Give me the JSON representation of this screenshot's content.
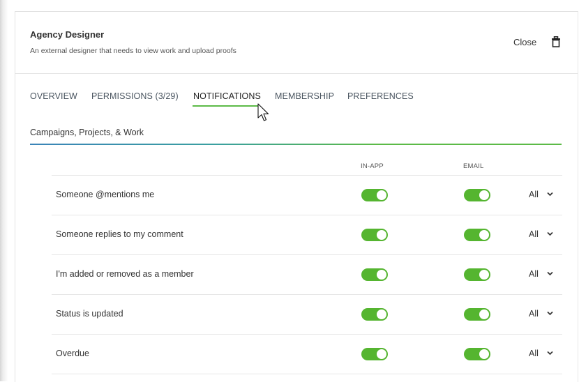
{
  "header": {
    "title": "Agency Designer",
    "subtitle": "An external designer that needs to view work and upload proofs",
    "close_label": "Close"
  },
  "tabs": [
    {
      "label": "OVERVIEW",
      "active": false
    },
    {
      "label": "PERMISSIONS (3/29)",
      "active": false
    },
    {
      "label": "NOTIFICATIONS",
      "active": true
    },
    {
      "label": "MEMBERSHIP",
      "active": false
    },
    {
      "label": "PREFERENCES",
      "active": false
    }
  ],
  "section": {
    "title": "Campaigns, Projects, & Work"
  },
  "table": {
    "columns": {
      "in_app": "IN-APP",
      "email": "EMAIL"
    },
    "rows": [
      {
        "label": "Someone @mentions me",
        "in_app": true,
        "email": true,
        "frequency": "All"
      },
      {
        "label": "Someone replies to my comment",
        "in_app": true,
        "email": true,
        "frequency": "All"
      },
      {
        "label": "I'm added or removed as a member",
        "in_app": true,
        "email": true,
        "frequency": "All"
      },
      {
        "label": "Status is updated",
        "in_app": true,
        "email": true,
        "frequency": "All"
      },
      {
        "label": "Overdue",
        "in_app": true,
        "email": true,
        "frequency": "All"
      }
    ]
  },
  "colors": {
    "accent": "#5cba47",
    "toggle_on": "#55b530",
    "rule_blue": "#3b84b8"
  },
  "icons": {
    "delete": "trash-icon",
    "dropdown": "chevron-down-icon",
    "pointer": "mouse-cursor-icon"
  }
}
